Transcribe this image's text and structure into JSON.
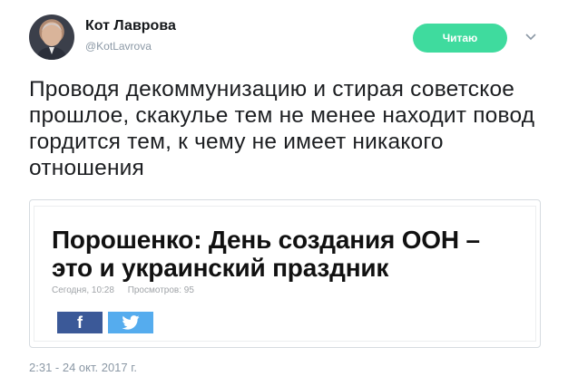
{
  "user": {
    "name": "Кот Лаврова",
    "handle": "@KotLavrova"
  },
  "follow_button": {
    "label": "Читаю",
    "color": "#3fdb9e"
  },
  "tweet": {
    "text": "Проводя декоммунизацию и стирая советское прошлое, скакулье тем не менее находит повод гордится тем, к чему не имеет никакого отношения",
    "timestamp": "2:31 - 24 окт. 2017 г."
  },
  "card": {
    "title": "Порошенко: День создания ООН – это и украинский праздник",
    "date": "Сегодня, 10:28",
    "views": "Просмотров: 95",
    "share_facebook": "f",
    "facebook_color": "#3b5998",
    "twitter_color": "#55acee"
  },
  "icons": {
    "avatar": "avatar",
    "chevron": "chevron-down-icon",
    "facebook": "facebook-icon",
    "twitter": "twitter-bird-icon"
  }
}
